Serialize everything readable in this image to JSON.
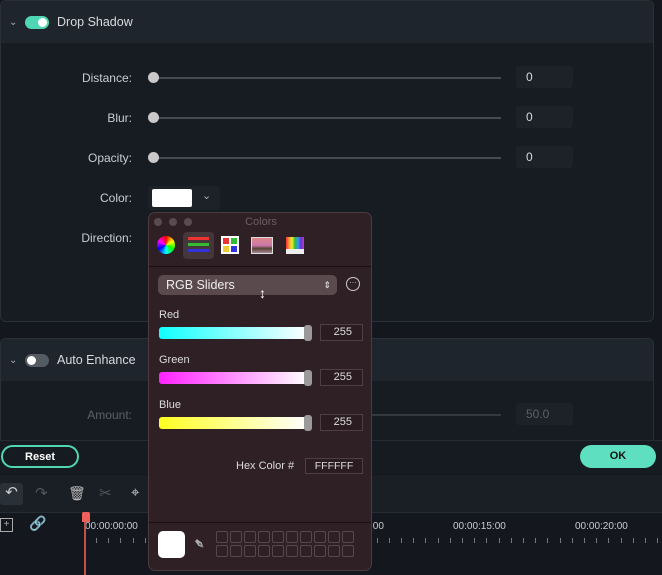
{
  "drop_shadow": {
    "title": "Drop Shadow",
    "enabled": true,
    "fields": [
      {
        "label": "Distance:",
        "value": "0"
      },
      {
        "label": "Blur:",
        "value": "0"
      },
      {
        "label": "Opacity:",
        "value": "0"
      }
    ],
    "color_label": "Color:",
    "color_value": "#FFFFFF",
    "direction_label": "Direction:"
  },
  "auto_enhance": {
    "title": "Auto Enhance",
    "enabled": false,
    "amount_label": "Amount:",
    "amount_value": "50.0"
  },
  "buttons": {
    "reset": "Reset",
    "ok": "OK"
  },
  "colors_panel": {
    "title": "Colors",
    "mode": "RGB Sliders",
    "tabs": [
      "color-wheel",
      "color-sliders",
      "color-palettes",
      "image-palettes",
      "pencils"
    ],
    "sliders": [
      {
        "label": "Red",
        "value": "255"
      },
      {
        "label": "Green",
        "value": "255"
      },
      {
        "label": "Blue",
        "value": "255"
      }
    ],
    "hex_label": "Hex Color #",
    "hex_value": "FFFFFF"
  },
  "timeline": {
    "timecodes": [
      "00:00:00:00",
      ":00",
      "00:00:15:00",
      "00:00:20:00"
    ]
  },
  "accent": "#4fd6b4"
}
